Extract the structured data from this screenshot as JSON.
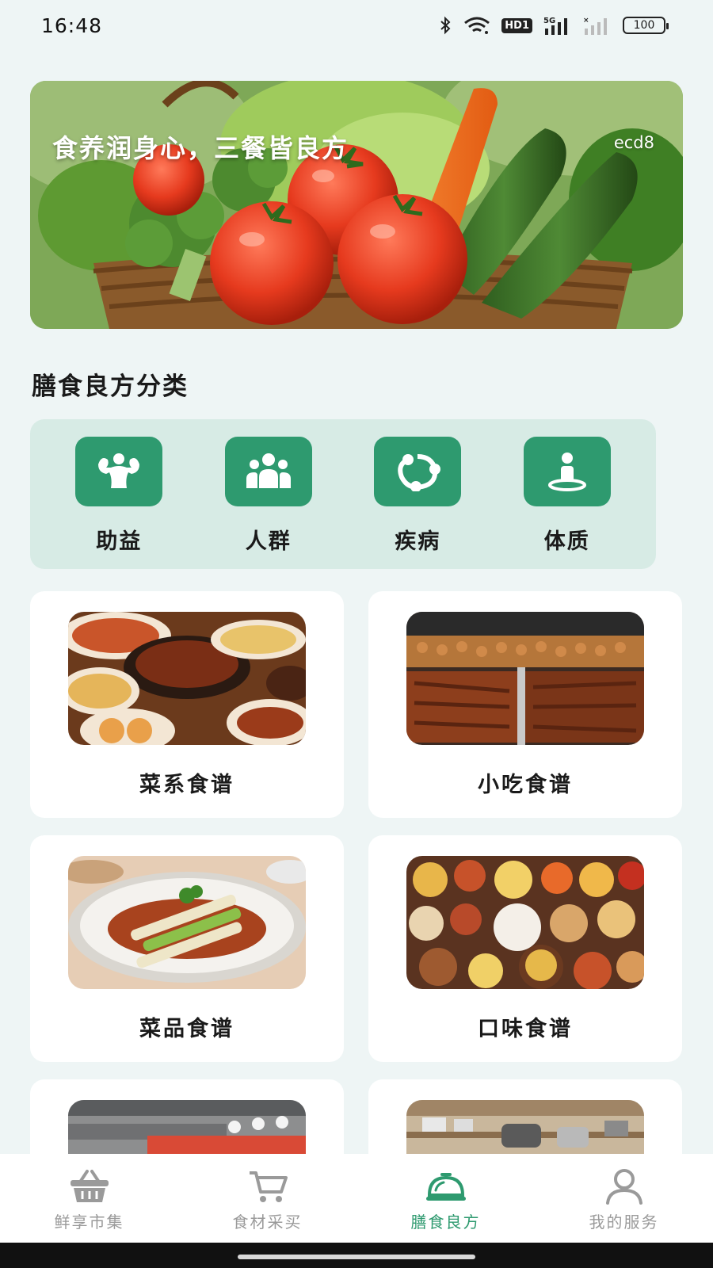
{
  "status_bar": {
    "time": "16:48",
    "hd": "HD1",
    "battery": "100",
    "icons": [
      "bluetooth-icon",
      "wifi-icon",
      "hd-icon",
      "signal-5g-icon",
      "signal-no-sim-icon",
      "battery-icon"
    ]
  },
  "banner": {
    "slogan": "食养润身心，三餐皆良方",
    "code": "ecd8"
  },
  "section": {
    "title": "膳食良方分类"
  },
  "categories": [
    {
      "label": "助益",
      "icon": "muscle-icon"
    },
    {
      "label": "人群",
      "icon": "people-group-icon"
    },
    {
      "label": "疾病",
      "icon": "virus-icon"
    },
    {
      "label": "体质",
      "icon": "person-standing-icon"
    }
  ],
  "recipes": [
    {
      "title": "菜系食谱"
    },
    {
      "title": "小吃食谱"
    },
    {
      "title": "菜品食谱"
    },
    {
      "title": "口味食谱"
    },
    {
      "title": ""
    },
    {
      "title": ""
    }
  ],
  "bottom_nav": [
    {
      "label": "鲜享市集",
      "icon": "basket-icon",
      "active": false
    },
    {
      "label": "食材采买",
      "icon": "cart-icon",
      "active": false
    },
    {
      "label": "膳食良方",
      "icon": "cloche-icon",
      "active": true
    },
    {
      "label": "我的服务",
      "icon": "user-icon",
      "active": false
    }
  ],
  "colors": {
    "accent": "#2e9a6f",
    "background": "#eef5f5",
    "category_panel": "#d7ebe5",
    "nav_inactive": "#9a9a9a"
  }
}
